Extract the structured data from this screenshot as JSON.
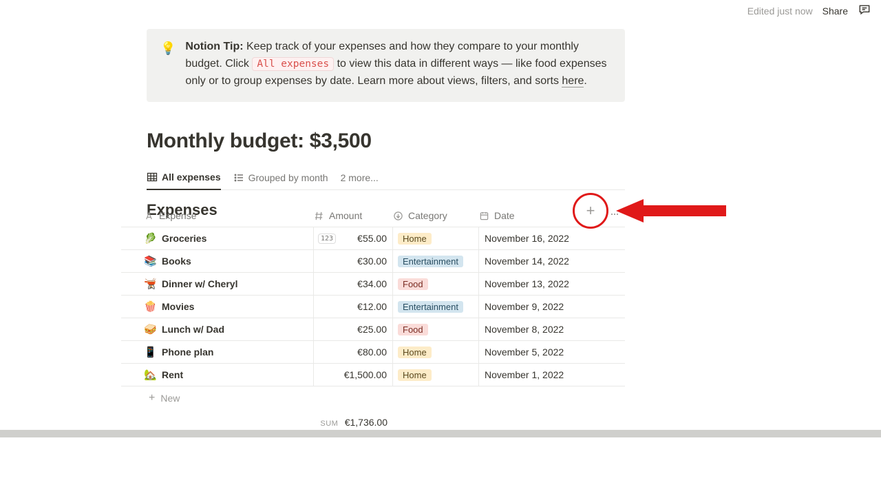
{
  "topbar": {
    "edited": "Edited just now",
    "share": "Share"
  },
  "tip": {
    "bulb": "💡",
    "bold": "Notion Tip:",
    "part1": " Keep track of your expenses and how they compare to your monthly budget. Click ",
    "code": "All expenses",
    "part2": " to view this data in different ways — like food expenses only or to group expenses by date. Learn more about views, filters, and sorts ",
    "here": "here",
    "period": "."
  },
  "heading": "Monthly budget: $3,500",
  "tabs": {
    "all": "All expenses",
    "grouped": "Grouped by month",
    "more": "2 more..."
  },
  "db_title": "Expenses",
  "columns": {
    "expense": "Expense",
    "amount": "Amount",
    "category": "Category",
    "date": "Date"
  },
  "categories": {
    "home": "Home",
    "entertainment": "Entertainment",
    "food": "Food"
  },
  "rows": [
    {
      "emoji": "🥬",
      "name": "Groceries",
      "amount": "€55.00",
      "cat": "home",
      "date": "November 16, 2022",
      "badge": "123"
    },
    {
      "emoji": "📚",
      "name": "Books",
      "amount": "€30.00",
      "cat": "entertainment",
      "date": "November 14, 2022"
    },
    {
      "emoji": "🫕",
      "name": "Dinner w/ Cheryl",
      "amount": "€34.00",
      "cat": "food",
      "date": "November 13, 2022"
    },
    {
      "emoji": "🍿",
      "name": "Movies",
      "amount": "€12.00",
      "cat": "entertainment",
      "date": "November 9, 2022"
    },
    {
      "emoji": "🥪",
      "name": "Lunch w/ Dad",
      "amount": "€25.00",
      "cat": "food",
      "date": "November 8, 2022"
    },
    {
      "emoji": "📱",
      "name": "Phone plan",
      "amount": "€80.00",
      "cat": "home",
      "date": "November 5, 2022"
    },
    {
      "emoji": "🏡",
      "name": "Rent",
      "amount": "€1,500.00",
      "cat": "home",
      "date": "November 1, 2022"
    }
  ],
  "newrow": "New",
  "sum": {
    "label": "SUM",
    "value": "€1,736.00"
  },
  "icons": {
    "plus": "+"
  }
}
